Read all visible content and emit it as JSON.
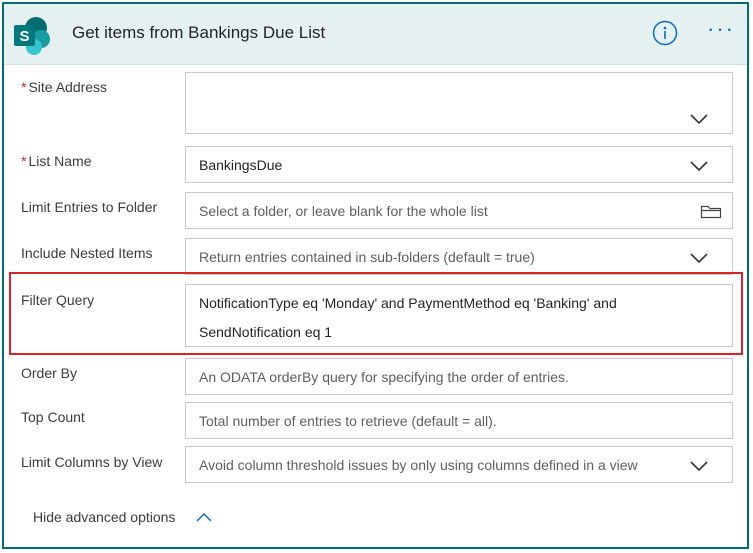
{
  "header": {
    "title": "Get items from Bankings Due List",
    "logo_icon": "sharepoint-icon",
    "info_icon": "info-icon",
    "more_label": "···"
  },
  "fields": {
    "site_address": {
      "label": "Site Address",
      "required": true,
      "value": ""
    },
    "list_name": {
      "label": "List Name",
      "required": true,
      "value": "BankingsDue"
    },
    "limit_folder": {
      "label": "Limit Entries to Folder",
      "placeholder": "Select a folder, or leave blank for the whole list"
    },
    "nested_items": {
      "label": "Include Nested Items",
      "placeholder": "Return entries contained in sub-folders (default = true)"
    },
    "filter_query": {
      "label": "Filter Query",
      "line1": "NotificationType eq 'Monday'  and PaymentMethod eq 'Banking'  and",
      "line2": "SendNotification eq 1"
    },
    "order_by": {
      "label": "Order By",
      "placeholder": "An ODATA orderBy query for specifying the order of entries."
    },
    "top_count": {
      "label": "Top Count",
      "placeholder": "Total number of entries to retrieve (default = all)."
    },
    "limit_columns": {
      "label": "Limit Columns by View",
      "placeholder": "Avoid column threshold issues by only using columns defined in a view"
    }
  },
  "footer": {
    "hide_advanced_label": "Hide advanced options"
  },
  "colors": {
    "accent": "#036c70",
    "header_bg": "#e5f0f0",
    "highlight": "#d8232a",
    "required": "#c0262f",
    "link": "#0b6ac7"
  }
}
